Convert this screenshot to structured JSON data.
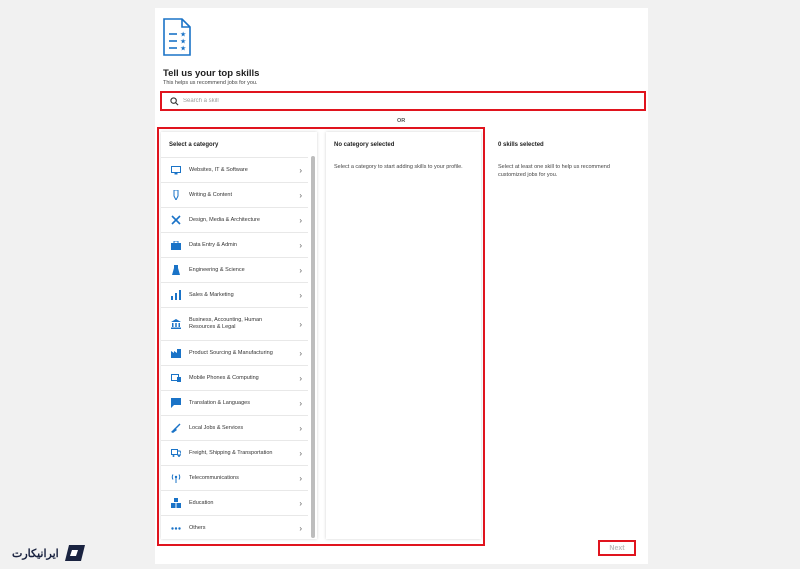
{
  "header": {
    "title": "Tell us your top skills",
    "subtitle": "This helps us recommend jobs for you."
  },
  "search": {
    "placeholder": "Search a skill",
    "value": ""
  },
  "divider": {
    "or_label": "OR"
  },
  "categories": {
    "heading": "Select a category",
    "items": [
      {
        "label": "Websites, IT & Software",
        "icon": "monitor-icon"
      },
      {
        "label": "Writing & Content",
        "icon": "pen-icon"
      },
      {
        "label": "Design, Media & Architecture",
        "icon": "design-tools-icon"
      },
      {
        "label": "Data Entry & Admin",
        "icon": "briefcase-icon"
      },
      {
        "label": "Engineering & Science",
        "icon": "flask-icon"
      },
      {
        "label": "Sales & Marketing",
        "icon": "chart-icon"
      },
      {
        "label": "Business, Accounting, Human Resources & Legal",
        "icon": "bank-icon"
      },
      {
        "label": "Product Sourcing & Manufacturing",
        "icon": "factory-icon"
      },
      {
        "label": "Mobile Phones & Computing",
        "icon": "devices-icon"
      },
      {
        "label": "Translation & Languages",
        "icon": "chat-bubble-icon"
      },
      {
        "label": "Local Jobs & Services",
        "icon": "broom-icon"
      },
      {
        "label": "Freight, Shipping & Transportation",
        "icon": "truck-icon"
      },
      {
        "label": "Telecommunications",
        "icon": "antenna-icon"
      },
      {
        "label": "Education",
        "icon": "blocks-icon"
      },
      {
        "label": "Others",
        "icon": "dots-icon"
      }
    ]
  },
  "middle_panel": {
    "heading": "No category selected",
    "text": "Select a category to start adding skills to your profile."
  },
  "right_panel": {
    "heading": "0 skills selected",
    "text": "Select at least one skill to help us recommend customized jobs for you."
  },
  "footer": {
    "next_label": "Next"
  },
  "watermark": {
    "text": "ایرانیکارت"
  },
  "colors": {
    "accent": "#1a73c7",
    "highlight": "#e0141e",
    "disabled": "#bdbdbd"
  }
}
